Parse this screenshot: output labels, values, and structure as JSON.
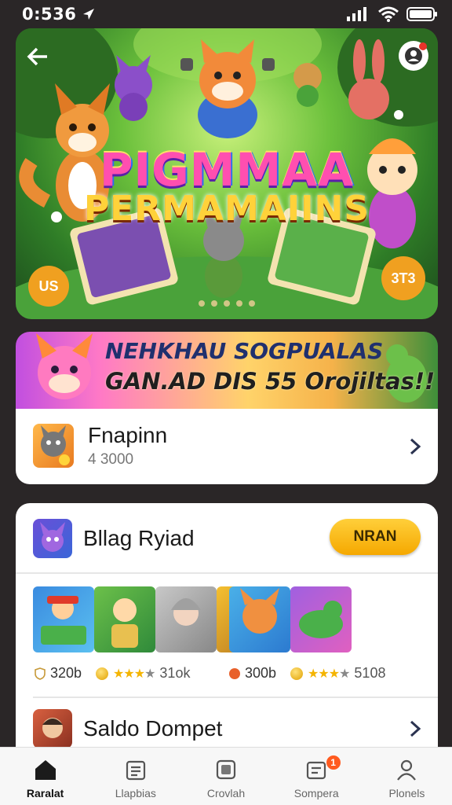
{
  "status_bar": {
    "time": "0:536",
    "icons": [
      "location-arrow-icon",
      "signal-icon",
      "wifi-icon",
      "battery-icon"
    ]
  },
  "hero": {
    "title_line1": "PIGMMAA",
    "title_line2": "PERMAMAIINS",
    "badge_left": "US",
    "badge_right": "3T3",
    "slide_count": 5,
    "icons": [
      "back-arrow-icon",
      "profile-icon"
    ]
  },
  "promo": {
    "line1": "NEHKHAU SOGPUALAS",
    "line2": "GAN.AD DIS 55 Orojiltas!!"
  },
  "balance_card": {
    "title": "Fnapinn",
    "subtitle": "4 3000",
    "icon": "game-character-icon"
  },
  "game_card": {
    "title": "Bllag Ryiad",
    "play_label": "NRAN",
    "games": [
      {
        "score": "320b",
        "rating": 3,
        "count": "31ok"
      },
      {
        "score": "300b",
        "rating": 3,
        "count": "5108"
      }
    ]
  },
  "wallet": {
    "title": "Saldo Dompet"
  },
  "nav": {
    "items": [
      {
        "label": "Raralat",
        "icon": "home-icon",
        "active": true
      },
      {
        "label": "Llapbias",
        "icon": "list-icon",
        "active": false
      },
      {
        "label": "Crovlah",
        "icon": "gallery-icon",
        "active": false
      },
      {
        "label": "Sompera",
        "icon": "cart-icon",
        "active": false,
        "badge": "1"
      },
      {
        "label": "Plonels",
        "icon": "user-icon",
        "active": false
      }
    ]
  },
  "colors": {
    "accent": "#ffc21a",
    "background": "#2a2627",
    "card": "#ffffff",
    "badge": "#ff5a1f"
  }
}
